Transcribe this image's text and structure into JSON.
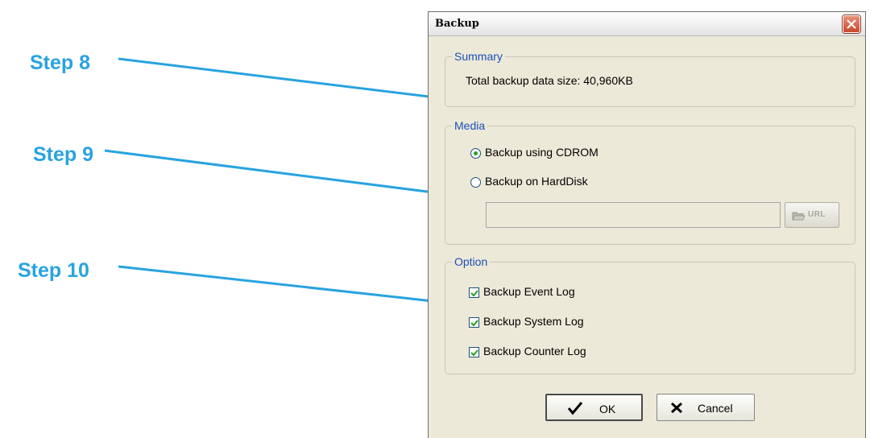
{
  "annotations": {
    "step8": "Step 8",
    "step9": "Step 9",
    "step10": "Step 10"
  },
  "dialog": {
    "title": "Backup",
    "summary": {
      "legend": "Summary",
      "text": "Total backup data size: 40,960KB"
    },
    "media": {
      "legend": "Media",
      "options": [
        {
          "label": "Backup using CDROM",
          "selected": true
        },
        {
          "label": "Backup on HardDisk",
          "selected": false
        }
      ],
      "path_value": "",
      "url_button_label": "URL"
    },
    "option": {
      "legend": "Option",
      "checkboxes": [
        {
          "label": "Backup Event Log",
          "checked": true
        },
        {
          "label": "Backup System Log",
          "checked": true
        },
        {
          "label": "Backup Counter Log",
          "checked": true
        }
      ]
    },
    "buttons": {
      "ok": "OK",
      "cancel": "Cancel"
    }
  },
  "colors": {
    "annotation": "#29a3e0",
    "legend": "#1c4fb8",
    "dialog_bg": "#ece9d8"
  }
}
